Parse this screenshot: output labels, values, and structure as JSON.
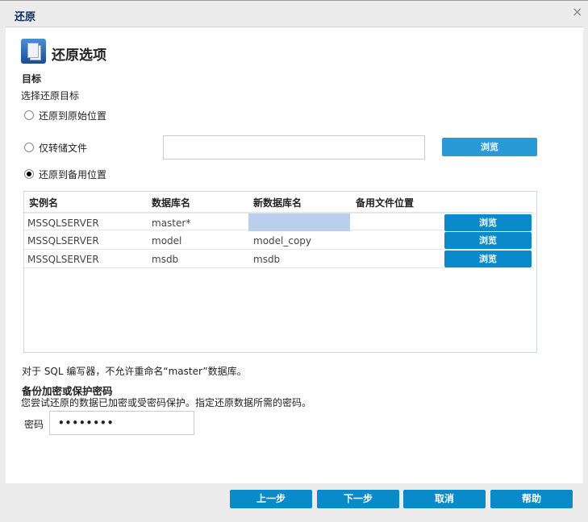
{
  "window": {
    "title": "还原",
    "close": "×"
  },
  "heading": "还原选项",
  "target": {
    "title": "目标",
    "subtitle": "选择还原目标",
    "options": [
      {
        "label": "还原到原始位置",
        "selected": false
      },
      {
        "label": "仅转储文件",
        "selected": false
      },
      {
        "label": "还原到备用位置",
        "selected": true
      }
    ],
    "dump_path": "",
    "browse": "浏览"
  },
  "table": {
    "headers": [
      "实例名",
      "数据库名",
      "新数据库名",
      "备用文件位置"
    ],
    "rows": [
      {
        "instance": "MSSQLSERVER",
        "db": "master*",
        "new_db": "",
        "location": "",
        "browse": "浏览"
      },
      {
        "instance": "MSSQLSERVER",
        "db": "model",
        "new_db": "model_copy",
        "location": "",
        "browse": "浏览"
      },
      {
        "instance": "MSSQLSERVER",
        "db": "msdb",
        "new_db": "msdb",
        "location": "",
        "browse": "浏览"
      }
    ]
  },
  "note": "对于 SQL 编写器，不允许重命名“master”数据库。",
  "encryption": {
    "title": "备份加密或保护密码",
    "desc": "您尝试还原的数据已加密或受密码保护。指定还原数据所需的密码。",
    "password_label": "密码",
    "password_value": "••••••••"
  },
  "footer": {
    "back": "上一步",
    "next": "下一步",
    "cancel": "取消",
    "help": "帮助"
  }
}
